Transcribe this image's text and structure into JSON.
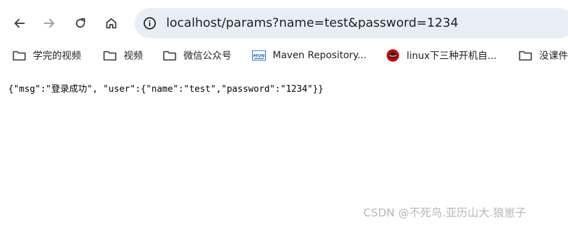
{
  "toolbar": {
    "back_icon": "back-arrow-icon",
    "forward_icon": "forward-arrow-icon",
    "reload_icon": "reload-icon",
    "home_icon": "home-icon",
    "site_info_icon": "info-icon",
    "url": "localhost/params?name=test&password=1234"
  },
  "bookmarks": [
    {
      "icon": "folder-icon",
      "label": "学完的视频"
    },
    {
      "icon": "folder-icon",
      "label": "视频"
    },
    {
      "icon": "folder-icon",
      "label": "微信公众号"
    },
    {
      "icon": "mvn-icon",
      "label": "Maven Repository..."
    },
    {
      "icon": "redhat-icon",
      "label": "linux下三种开机自..."
    },
    {
      "icon": "folder-icon",
      "label": "没课件"
    }
  ],
  "page": {
    "body_text": "{\"msg\":\"登录成功\", \"user\":{\"name\":\"test\",\"password\":\"1234\"}}"
  },
  "watermark": {
    "text": "CSDN @不死鸟.亚历山大.狼崽子"
  },
  "colors": {
    "omnibox_bg": "#e9eef6",
    "icon_dark": "#474747",
    "icon_disabled": "#9aa0a6",
    "mvn_blue": "#2f6fbf",
    "redhat_red": "#cc0000"
  }
}
